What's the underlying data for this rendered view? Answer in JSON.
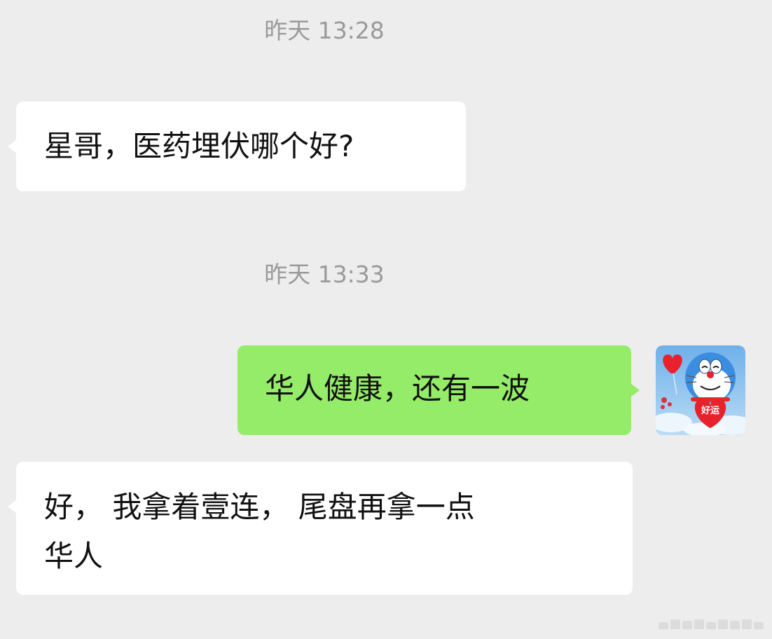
{
  "chat": {
    "messages": [
      {
        "type": "timestamp",
        "text": "昨天 13:28"
      },
      {
        "type": "incoming",
        "lines": [
          "星哥，医药埋伏哪个好?"
        ]
      },
      {
        "type": "timestamp",
        "text": "昨天 13:33"
      },
      {
        "type": "outgoing",
        "lines": [
          "华人健康，还有一波"
        ]
      },
      {
        "type": "incoming",
        "lines": [
          "好， 我拿着壹连， 尾盘再拿一点",
          "华人"
        ]
      }
    ]
  },
  "avatar": {
    "badge_text": "好运",
    "colors": {
      "sky": "#8fc4ef",
      "body": "#3b8de0",
      "heart": "#e8222d"
    }
  },
  "colors": {
    "background": "#ededed",
    "incoming_bubble": "#ffffff",
    "outgoing_bubble": "#95ec69",
    "timestamp_text": "#9a9a9a"
  }
}
